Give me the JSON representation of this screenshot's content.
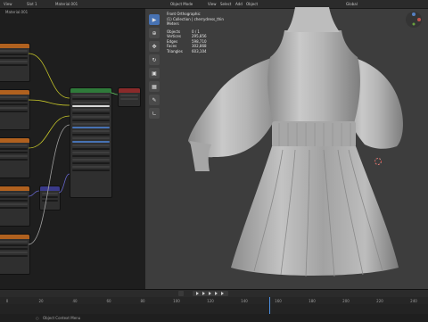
{
  "node_editor": {
    "header": {
      "view": "View",
      "object": "Slot 1",
      "material": "Material.001"
    },
    "breadcrumb": "Material.001"
  },
  "viewport": {
    "header": {
      "mode": "Object Mode",
      "menu": [
        "View",
        "Select",
        "Add",
        "Object"
      ],
      "transform": "Global"
    },
    "stats": {
      "title": "Front Orthographic",
      "collection": "(1) Collection | cherrydress_thin",
      "units": "Meters",
      "rows": [
        {
          "key": "Objects",
          "value": "0 / 1"
        },
        {
          "key": "Vertices",
          "value": "295,856"
        },
        {
          "key": "Edges",
          "value": "598,710"
        },
        {
          "key": "Faces",
          "value": "302,868"
        },
        {
          "key": "Triangles",
          "value": "603,104"
        }
      ]
    },
    "tools": [
      "select-icon",
      "cursor-icon",
      "move-icon",
      "rotate-icon",
      "scale-icon",
      "transform-icon",
      "annotate-icon",
      "measure-icon"
    ]
  },
  "timeline": {
    "ticks": [
      "0",
      "20",
      "40",
      "60",
      "80",
      "100",
      "120",
      "140",
      "160",
      "180",
      "200",
      "220",
      "240"
    ],
    "status": "Object Context Menu"
  }
}
